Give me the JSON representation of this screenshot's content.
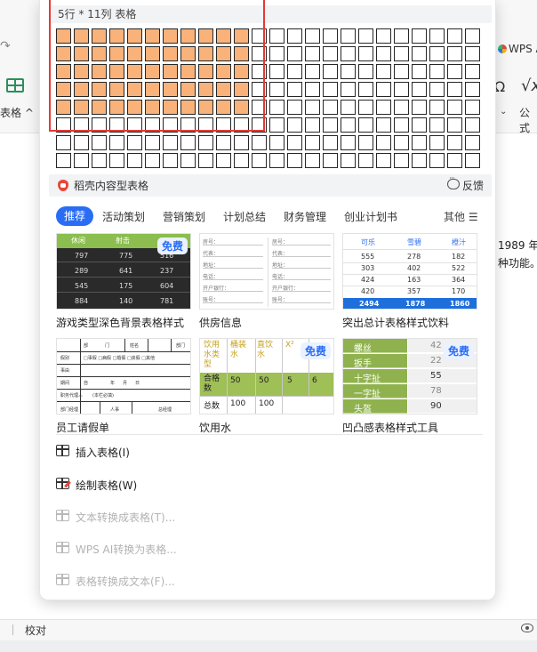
{
  "background": {
    "left_label": "表格",
    "right_app": "WPS A",
    "right_formula": "公式",
    "doc_lines": [
      "1989 年",
      "种功能。"
    ],
    "status_label": "校对"
  },
  "grid": {
    "title": "5行 * 11列 表格",
    "rows": 8,
    "cols": 24,
    "selected_rows": 5,
    "selected_cols": 11,
    "selected_color": "#f8b27a",
    "frame_color": "#e53935"
  },
  "daoke": {
    "label": "稻壳内容型表格",
    "feedback": "反馈"
  },
  "tabs": [
    {
      "label": "推荐",
      "active": true
    },
    {
      "label": "活动策划"
    },
    {
      "label": "营销策划"
    },
    {
      "label": "计划总结"
    },
    {
      "label": "财务管理"
    },
    {
      "label": "创业计划书"
    }
  ],
  "more_label": "其他 ☰",
  "free_badge": "免费",
  "templates": [
    {
      "label": "游戏类型深色背景表格样式",
      "headers": [
        "休闲",
        "射击"
      ],
      "rows": [
        [
          "797",
          "775",
          "516"
        ],
        [
          "289",
          "641",
          "237"
        ],
        [
          "545",
          "175",
          "604"
        ],
        [
          "884",
          "140",
          "781"
        ]
      ],
      "free": true
    },
    {
      "label": "供房信息",
      "fields": [
        "房号：",
        "代表：",
        "地址：",
        "电话：",
        "开户银行：",
        "账号："
      ]
    },
    {
      "label": "突出总计表格样式饮料",
      "headers": [
        "可乐",
        "雪碧",
        "橙汁"
      ],
      "rows": [
        [
          "555",
          "278",
          "182"
        ],
        [
          "303",
          "402",
          "522"
        ],
        [
          "424",
          "163",
          "364"
        ],
        [
          "420",
          "357",
          "170"
        ]
      ],
      "total": [
        "2494",
        "1878",
        "1860"
      ]
    },
    {
      "label": "员工请假单",
      "cells": [
        "部",
        "门",
        "姓名",
        "部门",
        "假别",
        "□事假 □病假 □婚假 □丧假 □其他",
        "事由",
        "期间",
        "自",
        "年",
        "月",
        "日",
        "职务代理人",
        "(本栏必填)",
        "部门经理",
        "人事",
        "总经理"
      ]
    },
    {
      "label": "饮用水",
      "headers": [
        "饮用水类型",
        "桶装水",
        "直饮水",
        "X²"
      ],
      "rows": [
        [
          "合格数",
          "50",
          "50",
          "5",
          "6"
        ],
        [
          "总数",
          "100",
          "100",
          "",
          ""
        ]
      ],
      "free": true
    },
    {
      "label": "凹凸感表格样式工具",
      "rows": [
        [
          "螺丝",
          "42"
        ],
        [
          "扳手",
          "22"
        ],
        [
          "十字扯",
          "55"
        ],
        [
          "一字扯",
          "78"
        ],
        [
          "头盔",
          "90"
        ]
      ],
      "free": true
    }
  ],
  "menu": [
    {
      "label": "插入表格(I)",
      "enabled": true,
      "icon": "insert-table-icon"
    },
    {
      "label": "绘制表格(W)",
      "enabled": true,
      "icon": "draw-table-icon"
    },
    {
      "label": "文本转换成表格(T)...",
      "enabled": false,
      "icon": "text-to-table-icon"
    },
    {
      "label": "WPS AI转换为表格...",
      "enabled": false,
      "icon": "ai-to-table-icon"
    },
    {
      "label": "表格转换成文本(F)...",
      "enabled": false,
      "icon": "table-to-text-icon"
    }
  ]
}
